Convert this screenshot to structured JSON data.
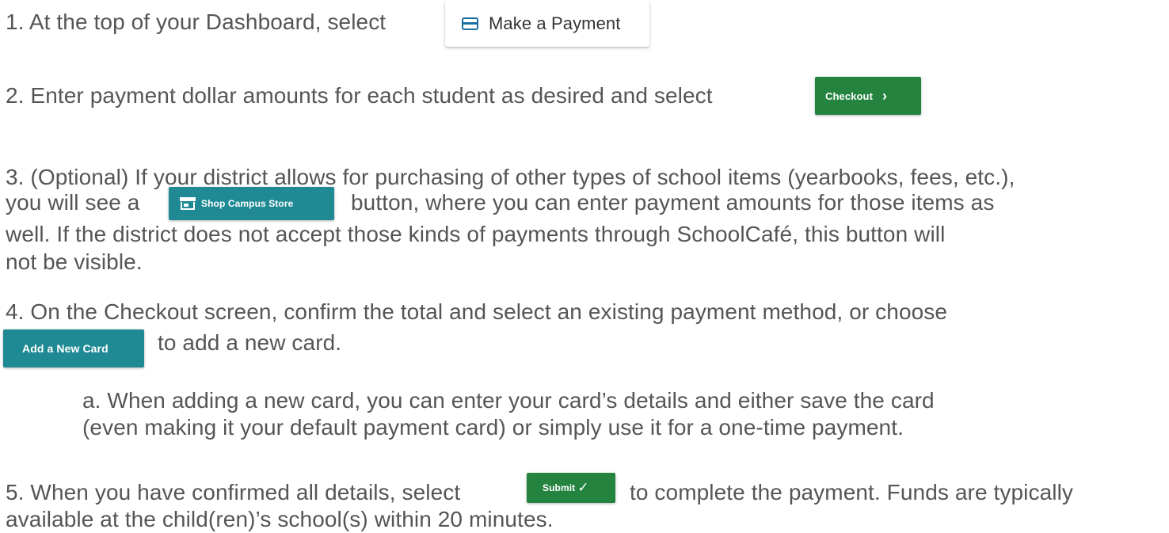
{
  "steps": {
    "s1": {
      "text": "1. At the top of your Dashboard, select",
      "button": "Make a Payment",
      "icon": "credit-card-icon"
    },
    "s2": {
      "text": "2. Enter payment dollar amounts for each student as desired and select",
      "button": "Checkout",
      "button_icon": "chevron-right-icon"
    },
    "s3": {
      "line1": "3. (Optional) If your district allows for purchasing of other types of school items (yearbooks, fees, etc.),",
      "line2_pre": "you will see a",
      "button": "Shop Campus Store",
      "button_icon": "store-icon",
      "line2_post": "button, where you can enter payment amounts for those items as",
      "line3": "well. If the district does not accept those kinds of payments through SchoolCafé, this button will",
      "line4": "not be visible."
    },
    "s4": {
      "line1": "4. On the Checkout screen, confirm the total and select an existing payment method, or choose",
      "button": "Add a New Card",
      "line2_post": "to add a new card.",
      "sub_a_line1": "a. When adding a new card, you can enter your card’s details and either save the card",
      "sub_a_line2": "(even making it your default payment card) or simply use it for a one-time payment."
    },
    "s5": {
      "line1_pre": "5. When you have confirmed all details, select",
      "button": "Submit",
      "button_icon": "checkmark-icon",
      "line1_post": "to complete the payment. Funds are typically",
      "line2": "available at the child(ren)’s school(s) within 20 minutes."
    }
  },
  "colors": {
    "text": "#555555",
    "green_button": "#23833f",
    "teal_button": "#1f8a94",
    "card_icon": "#1c6fa3"
  }
}
